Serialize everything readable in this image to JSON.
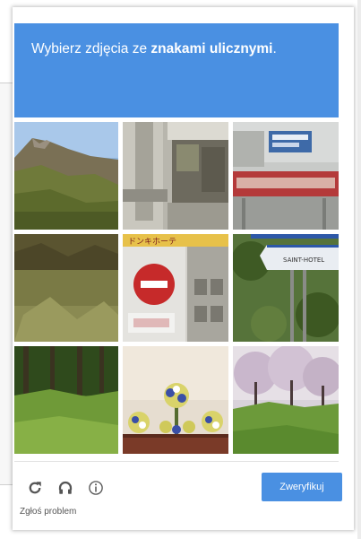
{
  "header": {
    "prompt_prefix": "Wybierz zdjęcia ze ",
    "prompt_bold": "znakami ulicznymi",
    "prompt_suffix": "."
  },
  "tiles": [
    {
      "subject": "mountain-hillside"
    },
    {
      "subject": "concrete-structure"
    },
    {
      "subject": "highway-overhead-sign"
    },
    {
      "subject": "grassy-field"
    },
    {
      "subject": "no-entry-sign",
      "sign_text": "ドンキホーテ"
    },
    {
      "subject": "direction-sign",
      "sign_text": "SAINT-HOTEL"
    },
    {
      "subject": "forest-meadow"
    },
    {
      "subject": "flower-arrangement"
    },
    {
      "subject": "blossoming-trees"
    }
  ],
  "footer": {
    "reload_icon": "reload-icon",
    "audio_icon": "headphones-icon",
    "info_icon": "info-icon",
    "report_label": "Zgłoś problem",
    "verify_label": "Zweryfikuj"
  },
  "colors": {
    "accent": "#4a90e2",
    "header_text": "#ffffff"
  }
}
